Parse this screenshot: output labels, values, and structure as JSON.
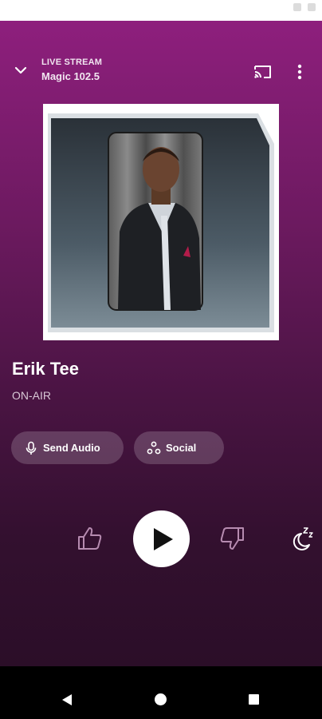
{
  "header": {
    "eyebrow": "LIVE STREAM",
    "station": "Magic 102.5",
    "icons": {
      "collapse": "chevron-down-icon",
      "cast": "cast-icon",
      "more": "more-vertical-icon"
    }
  },
  "now_playing": {
    "title": "Erik Tee",
    "subtitle": "ON-AIR"
  },
  "actions": {
    "send_audio_label": "Send Audio",
    "social_label": "Social",
    "send_audio_icon": "microphone-icon",
    "social_icon": "share-nodes-icon"
  },
  "controls": {
    "thumb_up_icon": "thumb-up-icon",
    "play_icon": "play-icon",
    "thumb_down_icon": "thumb-down-icon",
    "sleep_icon": "sleep-timer-icon"
  },
  "navigation": {
    "back_icon": "nav-back-icon",
    "home_icon": "nav-home-icon",
    "recents_icon": "nav-recents-icon"
  },
  "colors": {
    "gradient_top": "#8e1f7d",
    "gradient_bottom": "#2b0e28",
    "text_primary": "#ffffff",
    "text_secondary": "#d8c8d6",
    "pill_bg": "rgba(255,255,255,0.18)",
    "icon_muted": "#b68bb0"
  }
}
